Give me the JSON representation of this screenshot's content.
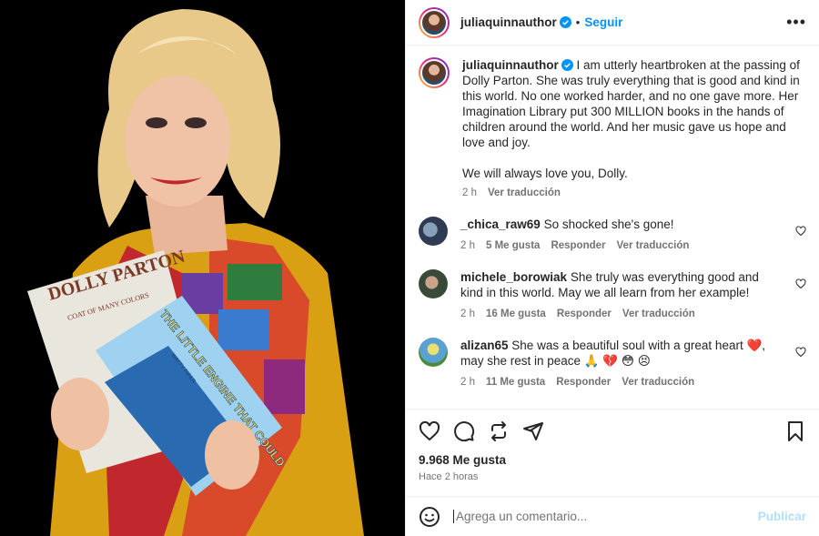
{
  "post": {
    "author": "juliaquinnauthor",
    "follow_label": "Seguir",
    "dot": "•",
    "caption": "I am utterly heartbroken at the passing of Dolly Parton. She was truly everything that is good and kind in this world. No one worked harder, and no one gave more. Her Imagination Library put 300 MILLION books in the hands of children around the world. And her music gave us hope and love and joy.",
    "caption2": "We will always love you, Dolly.",
    "caption_time": "2 h",
    "see_translation": "Ver traducción",
    "likes": "9.968 Me gusta",
    "posted": "Hace 2 horas"
  },
  "comments": [
    {
      "user": "_chica_raw69",
      "text": "So shocked she's gone!",
      "time": "2 h",
      "likes": "5 Me gusta",
      "reply": "Responder",
      "translate": "Ver traducción"
    },
    {
      "user": "michele_borowiak",
      "text": "She truly was everything good and kind in this world. May we all learn from her example!",
      "time": "2 h",
      "likes": "16 Me gusta",
      "reply": "Responder",
      "translate": "Ver traducción"
    },
    {
      "user": "alizan65",
      "text": "She was a beautiful soul with a great heart ❤️, may she rest in peace 🙏 💔 😳 😣",
      "time": "2 h",
      "likes": "11 Me gusta",
      "reply": "Responder",
      "translate": "Ver traducción"
    }
  ],
  "photo": {
    "book1_title": "DOLLY PARTON",
    "book1_sub": "COAT OF MANY COLORS",
    "book2_title": "THE LITTLE ENGINE THAT COULD",
    "book2_author": "WATTY PIPER"
  },
  "composer": {
    "placeholder": "Agrega un comentario...",
    "publish_label": "Publicar"
  },
  "icons": {
    "like": "heart-icon",
    "comment": "comment-icon",
    "share": "repost-icon",
    "send": "send-icon",
    "save": "bookmark-icon",
    "emoji": "emoji-icon",
    "more": "more-icon",
    "verified": "verified-badge-icon"
  },
  "colors": {
    "accent": "#0095f6",
    "publish_disabled": "#b2dffc",
    "verified": "#0095f6",
    "muted": "#737373"
  }
}
